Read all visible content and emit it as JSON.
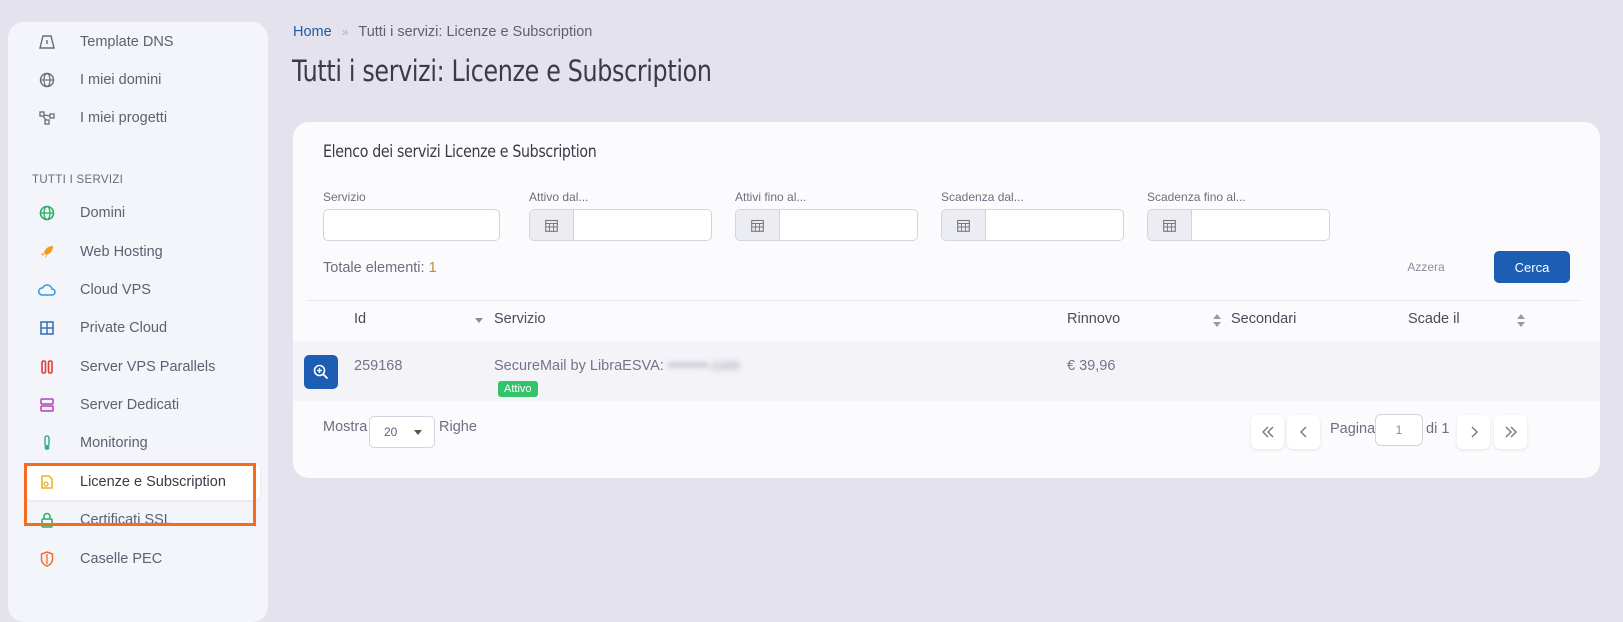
{
  "sidebar": {
    "items_top": [
      {
        "label": "Template DNS",
        "icon": "dns-template-icon"
      },
      {
        "label": "I miei domini",
        "icon": "globe-icon"
      },
      {
        "label": "I miei progetti",
        "icon": "project-nodes-icon"
      }
    ],
    "section_title": "TUTTI I SERVIZI",
    "items": [
      {
        "label": "Domini",
        "icon": "globe-icon",
        "color": "#27ae60"
      },
      {
        "label": "Web Hosting",
        "icon": "rocket-icon",
        "color": "#f39c12"
      },
      {
        "label": "Cloud VPS",
        "icon": "cloud-icon",
        "color": "#3498db"
      },
      {
        "label": "Private Cloud",
        "icon": "grid-icon",
        "color": "#2e6bb6"
      },
      {
        "label": "Server VPS Parallels",
        "icon": "parallels-icon",
        "color": "#e03a3a"
      },
      {
        "label": "Server Dedicati",
        "icon": "server-icon",
        "color": "#b43fb4"
      },
      {
        "label": "Monitoring",
        "icon": "thermometer-icon",
        "color": "#2fb58a"
      },
      {
        "label": "Licenze e Subscription",
        "icon": "license-icon",
        "color": "#e8b224",
        "active": true
      },
      {
        "label": "Certificati SSL",
        "icon": "lock-icon",
        "color": "#27ae60"
      },
      {
        "label": "Caselle PEC",
        "icon": "shield-icon",
        "color": "#f36c1f"
      }
    ]
  },
  "breadcrumb": {
    "home": "Home",
    "separator": "»",
    "current": "Tutti i servizi: Licenze e Subscription"
  },
  "page_title": "Tutti i servizi: Licenze e Subscription",
  "card": {
    "title": "Elenco dei servizi Licenze e Subscription",
    "filters": {
      "servizio": {
        "label": "Servizio",
        "value": ""
      },
      "attivo_dal": {
        "label": "Attivo dal...",
        "value": ""
      },
      "attivi_fino": {
        "label": "Attivi fino al...",
        "value": ""
      },
      "scadenza_dal": {
        "label": "Scadenza dal...",
        "value": ""
      },
      "scadenza_fino": {
        "label": "Scadenza fino al...",
        "value": ""
      }
    },
    "totale_label": "Totale elementi:",
    "totale_count": "1",
    "azzera": "Azzera",
    "cerca": "Cerca",
    "columns": {
      "id": "Id",
      "servizio": "Servizio",
      "rinnovo": "Rinnovo",
      "secondari": "Secondari",
      "scade_il": "Scade il"
    },
    "rows": [
      {
        "id": "259168",
        "servizio": "SecureMail by LibraESVA:",
        "servizio_blurred": "••••••••.com",
        "status": "Attivo",
        "rinnovo": "€ 39,96",
        "secondari": "",
        "scade_il": ""
      }
    ],
    "mostra": "Mostra",
    "page_size": "20",
    "righe": "Righe",
    "pagina": "Pagina",
    "current_page": "1",
    "di": "di 1"
  },
  "colors": {
    "accent": "#1b5eb4",
    "highlight": "#f36c1f",
    "status_active": "#33c36a"
  }
}
